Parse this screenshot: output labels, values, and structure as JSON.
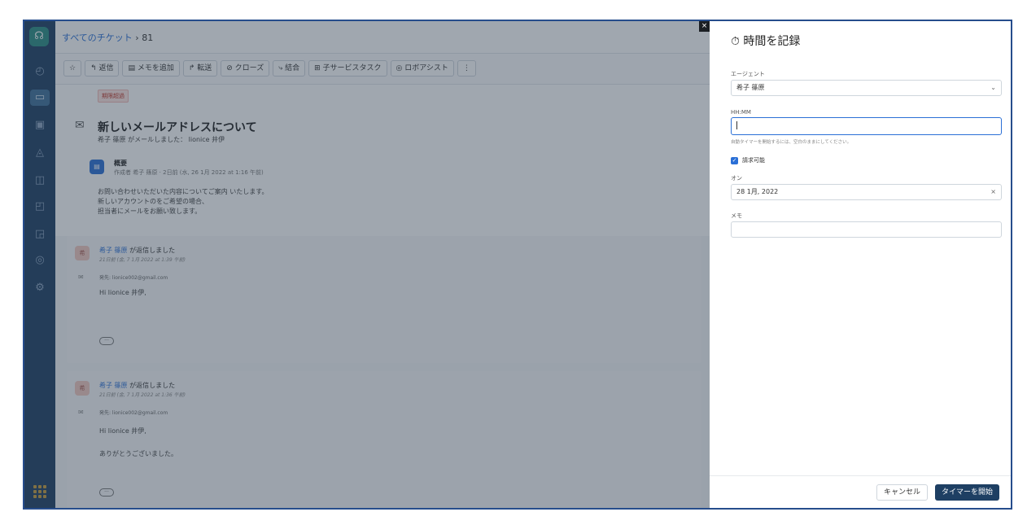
{
  "breadcrumb": {
    "all_tickets": "すべてのチケット",
    "sep": "›",
    "ticket_id": "81"
  },
  "toolbar": {
    "star": "☆",
    "reply": "↰ 返信",
    "add_note": "▤ メモを追加",
    "forward": "↱ 転送",
    "close": "⊘ クローズ",
    "merge": "⤷ 結合",
    "child_task": "⊞ 子サービスタスク",
    "robo_assist": "◎ ロボアシスト",
    "more": "⋮"
  },
  "ticket": {
    "deadline_badge": "期限超過",
    "title": "新しいメールアドレスについて",
    "subtitle": "希子 篠原 がメールしました： lionice 井伊",
    "summary": {
      "title": "概要",
      "meta": "作成者 希子 篠原 · 2日前 (水, 26 1月 2022 at 1:16 午前)",
      "lines": [
        "お問い合わせいただいた内容についてご案内 いたします。",
        "新しいアカウントのをご希望の場合、",
        "担当者にメールをお願い致します。"
      ]
    }
  },
  "replies": [
    {
      "avatar": "希",
      "agent": "希子 篠原",
      "action": " が返信しました",
      "time": "21日前 (金, 7 1月 2022 at 1:39 午前)",
      "from": "発先: lionice002@gmail.com",
      "lines": [
        "Hi lionice 井伊,"
      ]
    },
    {
      "avatar": "希",
      "agent": "希子 篠原",
      "action": " が返信しました",
      "time": "21日前 (金, 7 1月 2022 at 1:36 午前)",
      "from": "発先: lionice002@gmail.com",
      "lines": [
        "Hi lionice 井伊,",
        "ありがとうございました。"
      ]
    }
  ],
  "panel": {
    "close": "×",
    "title_icon": "⏱",
    "title": "時間を記録",
    "agent_label": "エージェント",
    "agent_value": "希子 篠原",
    "hhmm_label": "HH:MM",
    "hhmm_value": "",
    "hint": "自動タイマーを開始するには、空白のままにしてください。",
    "billable_label": "請求可能",
    "on_label": "オン",
    "date_value": "28 1月, 2022",
    "memo_label": "メモ",
    "memo_value": "",
    "cancel": "キャンセル",
    "start": "タイマーを開始"
  },
  "colors": {
    "primary": "#2a6fd6",
    "nav": "#1e3f63",
    "start_button": "#1e3f63"
  }
}
